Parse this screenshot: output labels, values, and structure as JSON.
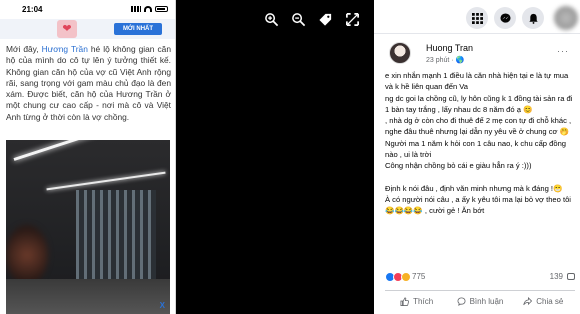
{
  "phone": {
    "time": "21:04",
    "ad_button": "MỚI NHẤT",
    "ad_close": "X",
    "article_parts": [
      {
        "text": "Mới đây, ",
        "hl": false
      },
      {
        "text": "Hương Trần",
        "hl": true
      },
      {
        "text": " hé lộ không gian căn hộ của mình do cô tự lên ý tưởng thiết kế. Không gian căn hộ của vợ cũ Việt Anh rộng rãi, sang trọng với gam màu chủ đạo là đen xám. Được biết, căn hộ của Hương Trần ở một chung cư cao cấp - nơi mà cô và Việt Anh từng ở thời còn là vợ chồng.",
        "hl": false
      }
    ]
  },
  "viewer": {
    "tools": [
      "zoom-in",
      "zoom-out",
      "tag",
      "fullscreen"
    ]
  },
  "facebook": {
    "author_name": "Huong Tran",
    "post_time": "23 phút · 🌎",
    "more": "···",
    "post_lines": [
      "e xin nhắn mạnh 1 điều là căn nhà hiện tại e là tự mua và k hề liên quan đến Va",
      "ng dc goi la chồng cũ, ly hôn cũng k 1 đồng tài sản ra đi 1 bàn tay trắng , lấy nhau dc 8 năm đó ạ 😊",
      ", nhà dg ở còn cho đi thuê để 2 mẹ con tự đi chỗ khác , nghe đâu thuê nhưng lại dẫn ny yêu về ở chung cơ 🤭",
      "Người ma 1 năm k hỏi con 1 câu nao, k chu cấp đồng nào , ui là trời",
      "Công nhận chồng bỏ cái e giàu hẳn ra ý :)))",
      "",
      "Định k nói đâu , định văn minh nhưng mà k đáng !😁",
      "À có người nói câu , a ấy k yêu tôi ma lại bỏ vợ theo tôi 😂😂😂😂 , cười gẻ ! Ăn bớt"
    ],
    "reaction_count": "775",
    "comment_count": "139",
    "actions": {
      "like": "Thích",
      "comment": "Bình luận",
      "share": "Chia sẻ"
    }
  },
  "colors": {
    "fb_blue": "#1877f2",
    "link_blue": "#2a6fd1",
    "viewer_bg": "#000000"
  }
}
